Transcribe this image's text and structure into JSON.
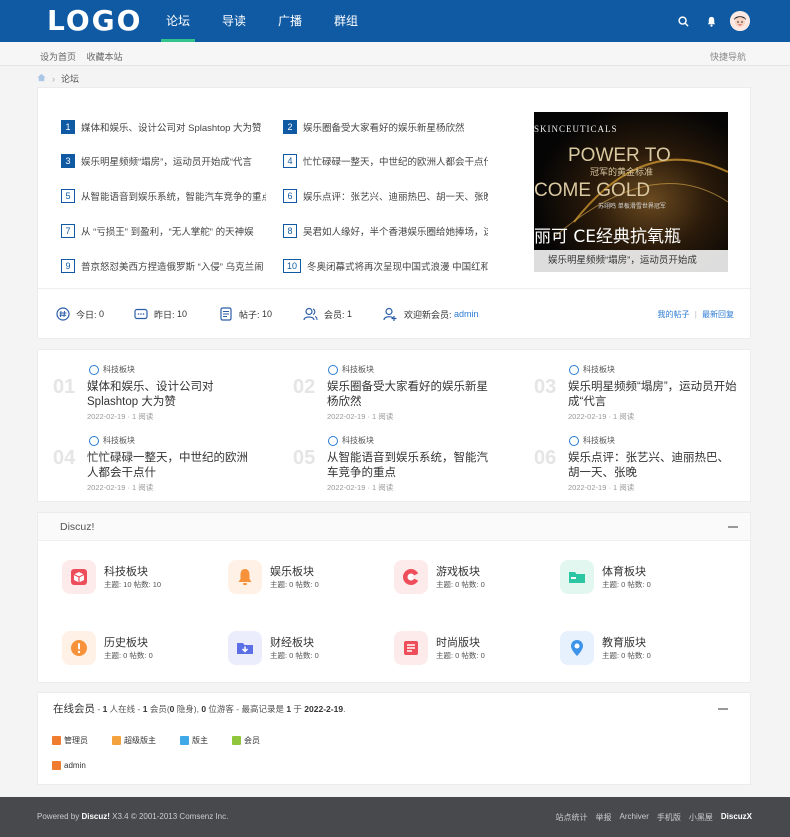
{
  "header": {
    "logo": "LOGO",
    "nav": [
      "论坛",
      "导读",
      "广播",
      "群组"
    ],
    "active_nav": 0
  },
  "topbar": {
    "set_home": "设为首页",
    "bookmark": "收藏本站",
    "quick_nav": "快捷导航"
  },
  "breadcrumb": {
    "current": "论坛"
  },
  "hot": {
    "items": [
      {
        "num": "1",
        "title": "媒体和娱乐、设计公司对 Splashtop 大为赞"
      },
      {
        "num": "2",
        "title": "娱乐圈备受大家看好的娱乐新星杨欣然"
      },
      {
        "num": "3",
        "title": "娱乐明星频频“塌房”，运动员开始成“代言"
      },
      {
        "num": "4",
        "title": "忙忙碌碌一整天，中世纪的欧洲人都会干点什"
      },
      {
        "num": "5",
        "title": "从智能语音到娱乐系统，智能汽车竞争的重点"
      },
      {
        "num": "6",
        "title": "娱乐点评：张艺兴、迪丽热巴、胡一天、张晚"
      },
      {
        "num": "7",
        "title": "从 “亏损王” 到盈利，“无人掌舵” 的天神娱"
      },
      {
        "num": "8",
        "title": "吴君如人缘好，半个香港娱乐圈给她捧场，这"
      },
      {
        "num": "9",
        "title": "普京怒怼美西方捏造俄罗斯 “入侵” 乌克兰闹"
      },
      {
        "num": "10",
        "title": "冬奥闭幕式将再次呈现中国式浪漫 中国红和"
      }
    ],
    "slide": {
      "brand": "SKINCEUTICALS",
      "line1": "POWER TO",
      "line2": "冠军的黄金标准",
      "line3": "COME GOLD",
      "line4": "苏翊鸣 单板滑雪世界冠军",
      "banner": "丽可 CE经典抗氧瓶",
      "caption": "娱乐明星频频“塌房”，运动员开始成"
    }
  },
  "stats": {
    "today_label": "今日:",
    "today_value": "0",
    "yesterday_label": "昨日:",
    "yesterday_value": "10",
    "posts_label": "帖子:",
    "posts_value": "10",
    "members_label": "会员:",
    "members_value": "1",
    "welcome_label": "欢迎新会员:",
    "welcome_user": "admin",
    "my_posts": "我的帖子",
    "separator": "|",
    "latest_reply": "最新回复"
  },
  "featured": [
    {
      "num": "01",
      "tag": "科技板块",
      "title": "媒体和娱乐、设计公司对 Splashtop 大为赞",
      "meta": "2022-02-19 · 1 阅读"
    },
    {
      "num": "02",
      "tag": "科技板块",
      "title": "娱乐圈备受大家看好的娱乐新星杨欣然",
      "meta": "2022-02-19 · 1 阅读"
    },
    {
      "num": "03",
      "tag": "科技板块",
      "title": "娱乐明星频频“塌房”，运动员开始成“代言",
      "meta": "2022-02-19 · 1 阅读"
    },
    {
      "num": "04",
      "tag": "科技板块",
      "title": "忙忙碌碌一整天，中世纪的欧洲人都会干点什",
      "meta": "2022-02-19 · 1 阅读"
    },
    {
      "num": "05",
      "tag": "科技板块",
      "title": "从智能语音到娱乐系统，智能汽车竞争的重点",
      "meta": "2022-02-19 · 1 阅读"
    },
    {
      "num": "06",
      "tag": "科技板块",
      "title": "娱乐点评：张艺兴、迪丽热巴、胡一天、张晚",
      "meta": "2022-02-19 · 1 阅读"
    }
  ],
  "discuz": {
    "title": "Discuz!",
    "forums": [
      {
        "name": "科技板块",
        "count": "主题: 10 帖数: 10",
        "bg": "#fdeaea",
        "fg": "#ee4d5a",
        "icon": "cube-icon"
      },
      {
        "name": "娱乐板块",
        "count": "主题: 0 帖数: 0",
        "bg": "#fff1e6",
        "fg": "#f7923a",
        "icon": "bell-icon"
      },
      {
        "name": "游戏板块",
        "count": "主题: 0 帖数: 0",
        "bg": "#fdeaea",
        "fg": "#ee4d5a",
        "icon": "game-icon"
      },
      {
        "name": "体育板块",
        "count": "主题: 0 帖数: 0",
        "bg": "#e3f7f1",
        "fg": "#2cc6a2",
        "icon": "folder-icon"
      },
      {
        "name": "历史板块",
        "count": "主题: 0 帖数: 0",
        "bg": "#fff1e6",
        "fg": "#f7923a",
        "icon": "info-icon"
      },
      {
        "name": "财经板块",
        "count": "主题: 0 帖数: 0",
        "bg": "#ebedfd",
        "fg": "#5b6fe6",
        "icon": "inbox-icon"
      },
      {
        "name": "时尚版块",
        "count": "主题: 0 帖数: 0",
        "bg": "#fdeaea",
        "fg": "#ee4d5a",
        "icon": "list-icon"
      },
      {
        "name": "教育版块",
        "count": "主题: 0 帖数: 0",
        "bg": "#e6f1fd",
        "fg": "#3d93ea",
        "icon": "pin-icon"
      }
    ]
  },
  "online": {
    "title": "在线会员",
    "sep1": " - ",
    "online_count": "1",
    "online_text": " 人在线 - ",
    "members_count": "1",
    "members_text": " 会员(",
    "hidden_count": "0",
    "hidden_text": " 隐身), ",
    "guests_count": "0",
    "guests_text": " 位游客 - 最高记录是 ",
    "record": "1",
    "on_text": " 于 ",
    "record_date": "2022-2-19",
    "end": ".",
    "legend": [
      {
        "label": "管理员",
        "color": "#f07c2f"
      },
      {
        "label": "超级版主",
        "color": "#f4a23c"
      },
      {
        "label": "版主",
        "color": "#3fa8e6"
      },
      {
        "label": "会员",
        "color": "#8fc63c"
      }
    ],
    "member": "admin"
  },
  "footer": {
    "powered": "Powered by ",
    "brand": "Discuz!",
    "version": " X3.4  © 2001-2013 Comsenz Inc.",
    "links": [
      "站点统计",
      "举报",
      "Archiver",
      "手机版",
      "小黑屋"
    ],
    "logo": "DiscuzX"
  }
}
